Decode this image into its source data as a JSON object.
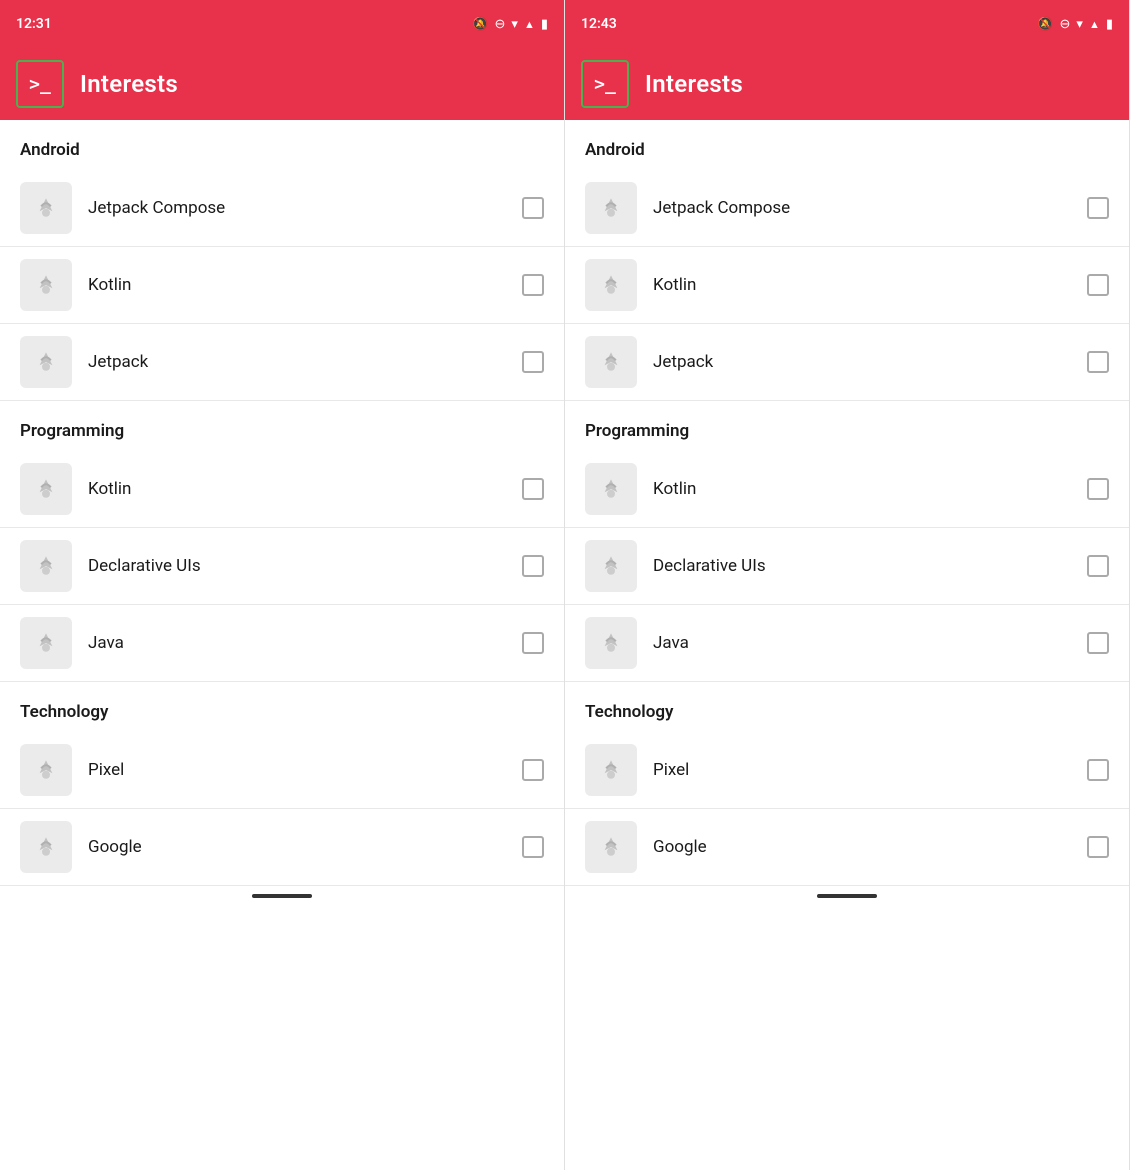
{
  "panels": [
    {
      "id": "panel-left",
      "status": {
        "time": "12:31",
        "icons": [
          "🔔",
          "⊖",
          "▼",
          "▲",
          "🔋"
        ]
      },
      "appBar": {
        "title": "Interests",
        "logoSymbol": ">_"
      },
      "sections": [
        {
          "label": "Android",
          "items": [
            {
              "name": "Jetpack Compose",
              "checked": false
            },
            {
              "name": "Kotlin",
              "checked": false
            },
            {
              "name": "Jetpack",
              "checked": false
            }
          ]
        },
        {
          "label": "Programming",
          "items": [
            {
              "name": "Kotlin",
              "checked": false
            },
            {
              "name": "Declarative UIs",
              "checked": false
            },
            {
              "name": "Java",
              "checked": false
            }
          ]
        },
        {
          "label": "Technology",
          "items": [
            {
              "name": "Pixel",
              "checked": false
            },
            {
              "name": "Google",
              "checked": false
            }
          ]
        }
      ]
    },
    {
      "id": "panel-right",
      "status": {
        "time": "12:43",
        "icons": [
          "🔔",
          "⊖",
          "▼",
          "▲",
          "🔋"
        ]
      },
      "appBar": {
        "title": "Interests",
        "logoSymbol": ">_"
      },
      "sections": [
        {
          "label": "Android",
          "items": [
            {
              "name": "Jetpack Compose",
              "checked": false
            },
            {
              "name": "Kotlin",
              "checked": false
            },
            {
              "name": "Jetpack",
              "checked": false
            }
          ]
        },
        {
          "label": "Programming",
          "items": [
            {
              "name": "Kotlin",
              "checked": false
            },
            {
              "name": "Declarative UIs",
              "checked": false
            },
            {
              "name": "Java",
              "checked": false
            }
          ]
        },
        {
          "label": "Technology",
          "items": [
            {
              "name": "Pixel",
              "checked": false
            },
            {
              "name": "Google",
              "checked": false
            }
          ]
        }
      ]
    }
  ],
  "colors": {
    "accent": "#e8314a",
    "logoOutline": "#4caf50",
    "sectionHeader": "#1a1a1a",
    "itemText": "#1a1a1a",
    "checkboxBorder": "#aaa",
    "iconBg": "#ebebeb"
  }
}
